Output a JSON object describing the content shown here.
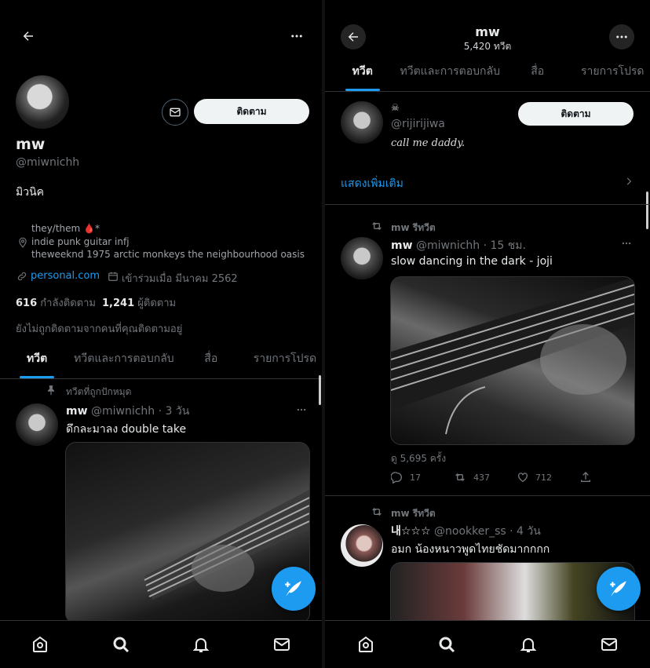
{
  "left": {
    "profile": {
      "name": "mw",
      "handle": "@miwnichh",
      "display_bio": "มิวนิค",
      "bio_line1": "they/them 🩸*",
      "bio_line2": "indie punk guitar infj",
      "bio_line3": "theweeknd 1975 arctic monkeys the neighbourhood oasis",
      "link": "personal.com",
      "joined": "เข้าร่วมเมื่อ มีนาคม 2562",
      "following_count": "616",
      "following_label": "กำลังติดตาม",
      "followers_count": "1,241",
      "followers_label": "ผู้ติดตาม",
      "not_followed_note": "ยังไม่ถูกติดตามจากคนที่คุณติดตามอยู่",
      "follow_button": "ติดตาม"
    },
    "tabs": [
      "ทวีต",
      "ทวีตและการตอบกลับ",
      "สื่อ",
      "รายการโปรด"
    ],
    "pinned_label": "ทวีตที่ถูกปักหมุด",
    "tweet": {
      "name": "mw",
      "handle": "@miwnichh",
      "time": "· 3 วัน",
      "text": "ดึกละมาลง double take"
    }
  },
  "right": {
    "header": {
      "title": "mw",
      "subtitle": "5,420 ทวีต"
    },
    "tabs": [
      "ทวีต",
      "ทวีตและการตอบกลับ",
      "สื่อ",
      "รายการโปรด"
    ],
    "follow_card": {
      "emoji": "☠",
      "handle": "@rijirijiwa",
      "bio": "call me daddy.",
      "follow_button": "ติดตาม"
    },
    "show_more": "แสดงเพิ่มเติม",
    "tweet1": {
      "retweet_label": "mw รีทวีต",
      "name": "mw",
      "handle": "@miwnichh",
      "time": "· 15 ชม.",
      "text": "slow dancing in the dark - joji",
      "views": "ดู 5,695 ครั้ง",
      "replies": "17",
      "retweets": "437",
      "likes": "712"
    },
    "tweet2": {
      "retweet_label": "mw รีทวีต",
      "name": "내☆☆☆",
      "handle": "@nookker_ss",
      "time": "· 4 วัน",
      "text": "อมก น้องหนาวพูดไทยชัดมากกกก"
    }
  },
  "colors": {
    "accent": "#1d9bf0",
    "background": "#000000",
    "muted": "#71767b"
  },
  "icons": [
    "back-arrow-icon",
    "more-icon",
    "mail-icon",
    "location-icon",
    "link-icon",
    "calendar-icon",
    "pin-icon",
    "retweet-icon",
    "reply-icon",
    "like-icon",
    "share-icon",
    "compose-icon",
    "home-icon",
    "search-icon",
    "bell-icon",
    "chevron-right-icon"
  ]
}
